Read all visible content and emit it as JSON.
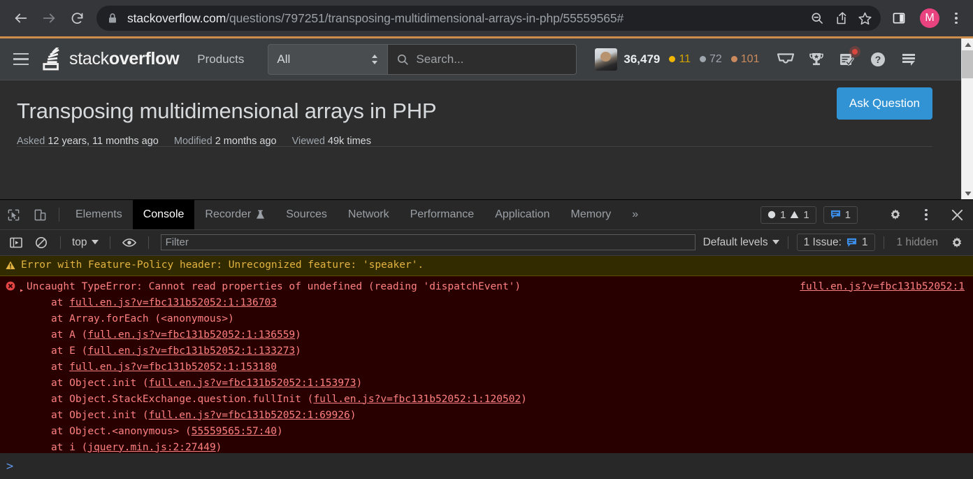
{
  "browser": {
    "url_domain": "stackoverflow.com",
    "url_path": "/questions/797251/transposing-multidimensional-arrays-in-php/55559565#",
    "back_label": "Back",
    "forward_label": "Forward",
    "reload_label": "Reload",
    "avatar_letter": "M",
    "icons": {
      "lock": "lock-icon",
      "search": "search-icon",
      "share": "share-icon",
      "bookmark": "star-icon",
      "side_panel": "side-panel-icon",
      "menu": "kebab-menu-icon"
    },
    "accent_color": "#cf8d4b"
  },
  "site_header": {
    "logo_light": "stack",
    "logo_bold": "overflow",
    "products_label": "Products",
    "filter_select_value": "All",
    "search_placeholder": "Search...",
    "reputation": "36,479",
    "badges": [
      {
        "name": "gold",
        "count": "11",
        "color": "#f1b600"
      },
      {
        "name": "silver",
        "count": "72",
        "color": "#9fa6ad"
      },
      {
        "name": "bronze",
        "count": "101",
        "color": "#cb8a5d"
      }
    ],
    "icons": [
      "inbox-icon",
      "trophy-icon",
      "review-queue-icon",
      "help-icon",
      "chat-icon"
    ],
    "review_has_notification": true
  },
  "question": {
    "title": "Transposing multidimensional arrays in PHP",
    "meta": [
      {
        "label": "Asked",
        "value": "12 years, 11 months ago"
      },
      {
        "label": "Modified",
        "value": "2 months ago"
      },
      {
        "label": "Viewed",
        "value": "49k times"
      }
    ],
    "ask_button": "Ask Question",
    "ask_button_color": "#3192d4"
  },
  "devtools": {
    "tabs": [
      {
        "label": "Elements",
        "active": false
      },
      {
        "label": "Console",
        "active": true
      },
      {
        "label": "Recorder",
        "active": false,
        "icon": "beaker-icon"
      },
      {
        "label": "Sources",
        "active": false
      },
      {
        "label": "Network",
        "active": false
      },
      {
        "label": "Performance",
        "active": false
      },
      {
        "label": "Application",
        "active": false
      },
      {
        "label": "Memory",
        "active": false
      }
    ],
    "overflow_label": "»",
    "error_count": "1",
    "warning_count": "1",
    "issue_count": "1",
    "left_icons": [
      "inspect-element-icon",
      "device-toolbar-icon"
    ],
    "right_icons": [
      "settings-gear-icon",
      "kebab-menu-icon",
      "close-icon"
    ],
    "filter_bar": {
      "sidebar_toggle": "console-sidebar-icon",
      "clear_console": "clear-console-icon",
      "context": "top",
      "eye_icon": "live-expression-eye-icon",
      "filter_placeholder": "Filter",
      "levels_label": "Default levels",
      "issue_label": "1 Issue:",
      "issue_badge_count": "1",
      "hidden_label": "1 hidden",
      "settings_icon": "settings-gear-icon"
    },
    "prompt_symbol": ">"
  },
  "console_messages": [
    {
      "type": "warning",
      "icon": "warning-triangle-icon",
      "text": "Error with Feature-Policy header: Unrecognized feature: 'speaker'."
    },
    {
      "type": "error",
      "icon": "error-circle-icon",
      "expander": "▸",
      "headline": "Uncaught TypeError: Cannot read properties of undefined (reading 'dispatchEvent')",
      "source_link": "full.en.js?v=fbc131b52052:1",
      "stack": [
        {
          "prefix": "    at ",
          "fn": "",
          "open": "",
          "link": "full.en.js?v=fbc131b52052:1:136703",
          "close": ""
        },
        {
          "prefix": "    at ",
          "fn": "Array.forEach ",
          "open": "(<anonymous>)",
          "link": "",
          "close": ""
        },
        {
          "prefix": "    at ",
          "fn": "A ",
          "open": "(",
          "link": "full.en.js?v=fbc131b52052:1:136559",
          "close": ")"
        },
        {
          "prefix": "    at ",
          "fn": "E ",
          "open": "(",
          "link": "full.en.js?v=fbc131b52052:1:133273",
          "close": ")"
        },
        {
          "prefix": "    at ",
          "fn": "",
          "open": "",
          "link": "full.en.js?v=fbc131b52052:1:153180",
          "close": ""
        },
        {
          "prefix": "    at ",
          "fn": "Object.init ",
          "open": "(",
          "link": "full.en.js?v=fbc131b52052:1:153973",
          "close": ")"
        },
        {
          "prefix": "    at ",
          "fn": "Object.StackExchange.question.fullInit ",
          "open": "(",
          "link": "full.en.js?v=fbc131b52052:1:120502",
          "close": ")"
        },
        {
          "prefix": "    at ",
          "fn": "Object.init ",
          "open": "(",
          "link": "full.en.js?v=fbc131b52052:1:69926",
          "close": ")"
        },
        {
          "prefix": "    at ",
          "fn": "Object.<anonymous> ",
          "open": "(",
          "link": "55559565:57:40",
          "close": ")"
        },
        {
          "prefix": "    at ",
          "fn": "i ",
          "open": "(",
          "link": "jquery.min.js:2:27449",
          "close": ")"
        }
      ]
    }
  ]
}
